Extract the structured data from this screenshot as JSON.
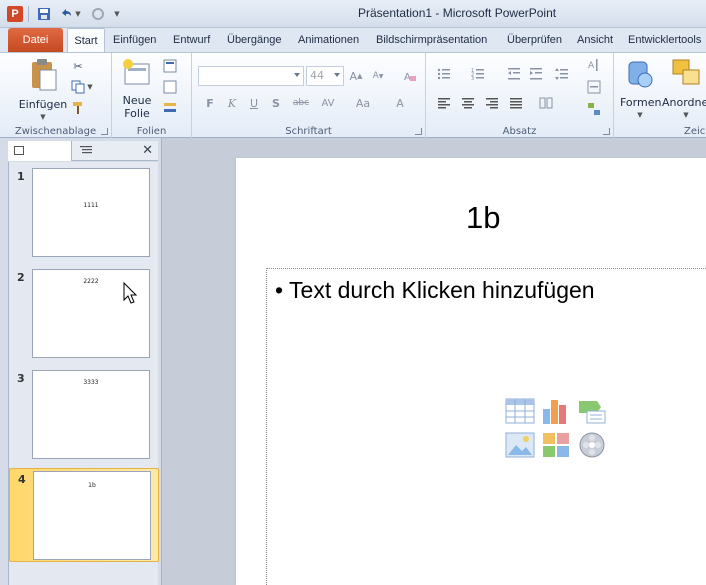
{
  "window": {
    "title": "Präsentation1 - Microsoft PowerPoint",
    "app_icon_letter": "P"
  },
  "tabs": {
    "file": "Datei",
    "start": "Start",
    "insert": "Einfügen",
    "design": "Entwurf",
    "transitions": "Übergänge",
    "animations": "Animationen",
    "slideshow": "Bildschirmpräsentation",
    "review": "Überprüfen",
    "view": "Ansicht",
    "developer": "Entwicklertools"
  },
  "ribbon": {
    "clipboard": {
      "label": "Zwischenablage",
      "paste": "Einfügen"
    },
    "slides": {
      "label": "Folien",
      "new_slide_line1": "Neue",
      "new_slide_line2": "Folie"
    },
    "font": {
      "label": "Schriftart",
      "font_name": "",
      "font_size": "44",
      "bold": "F",
      "italic": "K",
      "underline": "U",
      "shadow": "S",
      "strike": "abc",
      "spacing": "AV",
      "case": "Aa",
      "color": "A"
    },
    "paragraph": {
      "label": "Absatz"
    },
    "drawing": {
      "shapes": "Formen",
      "arrange": "Anordnen",
      "label": "Zeic"
    }
  },
  "slides_pane": {
    "slides": [
      {
        "number": "1",
        "thumb_text": "1111"
      },
      {
        "number": "2",
        "thumb_text": "2222"
      },
      {
        "number": "3",
        "thumb_text": "3333"
      },
      {
        "number": "4",
        "thumb_text": "1b"
      }
    ],
    "selected_index": 3
  },
  "slide": {
    "title": "1b",
    "bullet": "Text durch Klicken hinzufügen"
  },
  "colors": {
    "file_tab": "#d24726",
    "selection": "#ffd76b",
    "brand": "#d24726"
  }
}
